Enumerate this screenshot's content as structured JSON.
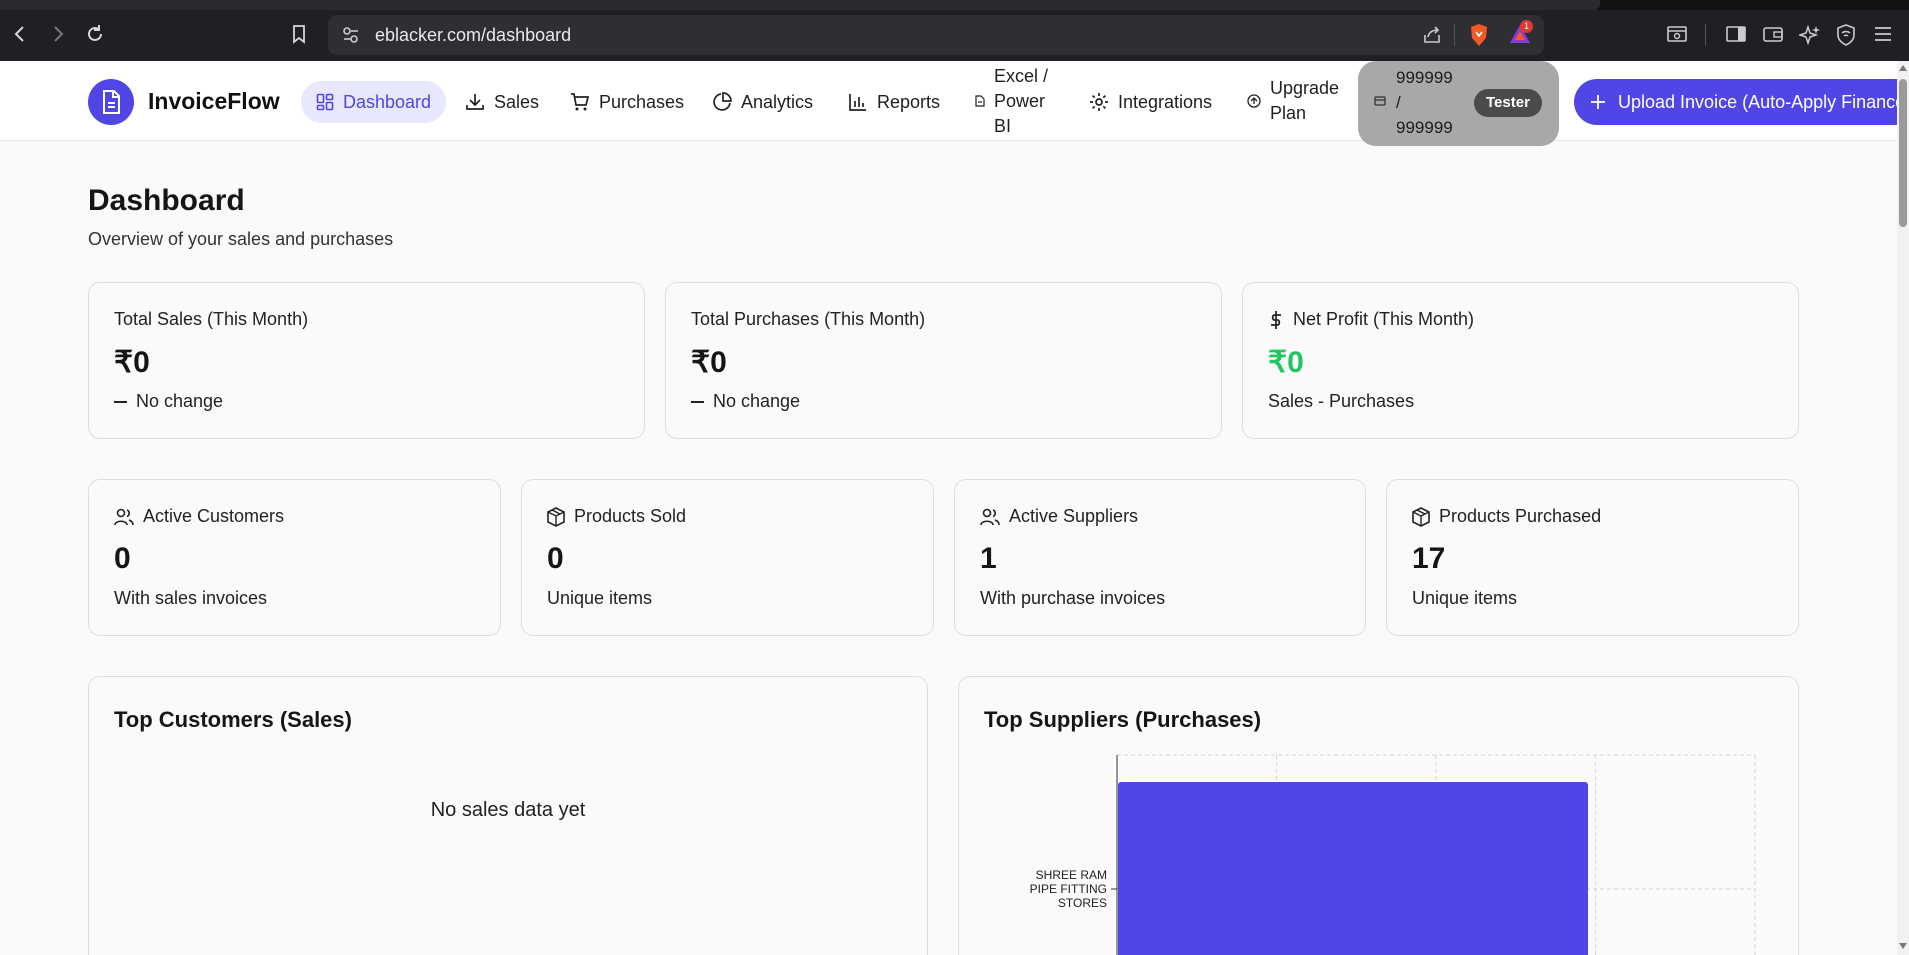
{
  "browser": {
    "url": "eblacker.com/dashboard",
    "notification_count": "1"
  },
  "header": {
    "brand": "InvoiceFlow",
    "nav": [
      {
        "label": "Dashboard"
      },
      {
        "label": "Sales"
      },
      {
        "label": "Purchases"
      },
      {
        "label": "Analytics"
      },
      {
        "label": "Reports"
      },
      {
        "label_lines": [
          "Excel /",
          "Power",
          "BI"
        ]
      },
      {
        "label": "Integrations"
      },
      {
        "label_lines": [
          "Upgrade",
          "Plan"
        ]
      }
    ],
    "quota": {
      "lines": [
        "999999",
        "/",
        "999999"
      ],
      "badge": "Tester"
    },
    "upload_button": "Upload Invoice (Auto-Apply Finance"
  },
  "page": {
    "title": "Dashboard",
    "subtitle": "Overview of your sales and purchases"
  },
  "summary_cards": [
    {
      "label": "Total Sales (This Month)",
      "value": "₹0",
      "foot": "No change"
    },
    {
      "label": "Total Purchases (This Month)",
      "value": "₹0",
      "foot": "No change"
    },
    {
      "label": "Net Profit (This Month)",
      "value": "₹0",
      "foot": "Sales - Purchases"
    }
  ],
  "stat_cards": [
    {
      "label": "Active Customers",
      "value": "0",
      "foot": "With sales invoices"
    },
    {
      "label": "Products Sold",
      "value": "0",
      "foot": "Unique items"
    },
    {
      "label": "Active Suppliers",
      "value": "1",
      "foot": "With purchase invoices"
    },
    {
      "label": "Products Purchased",
      "value": "17",
      "foot": "Unique items"
    }
  ],
  "top_customers": {
    "title": "Top Customers (Sales)",
    "empty": "No sales data yet"
  },
  "top_suppliers": {
    "title": "Top Suppliers (Purchases)"
  },
  "colors": {
    "accent": "#4f46e5",
    "positive": "#22c55e"
  },
  "chart_data": {
    "type": "bar",
    "orientation": "horizontal",
    "categories": [
      [
        "SHREE RAM",
        "PIPE FITTING",
        "STORES"
      ]
    ],
    "values": [
      1
    ],
    "grid": true,
    "color": "#4f46e5"
  }
}
